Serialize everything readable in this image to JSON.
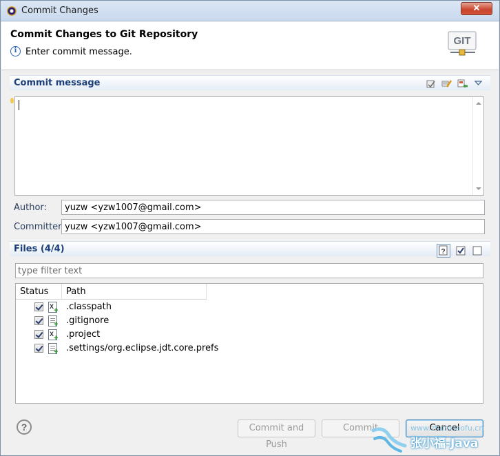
{
  "window": {
    "title": "Commit Changes",
    "close_label": "✕"
  },
  "header": {
    "title": "Commit Changes to Git Repository",
    "message": "Enter commit message.",
    "logo_text": "GIT"
  },
  "commit_message": {
    "section_title": "Commit message",
    "value": "",
    "tool_icons": [
      "spellcheck-icon",
      "edit-message-icon",
      "signed-off-icon",
      "view-menu-icon"
    ]
  },
  "author": {
    "label": "Author:",
    "value": "yuzw <yzw1007@gmail.com>"
  },
  "committer": {
    "label": "Committer:",
    "value": "yuzw <yzw1007@gmail.com>"
  },
  "files": {
    "section_title": "Files (4/4)",
    "filter_placeholder": "type filter text",
    "columns": [
      "Status",
      "Path"
    ],
    "rows": [
      {
        "path": ".classpath",
        "checked": true,
        "icon": "xml-file-add-icon"
      },
      {
        "path": ".gitignore",
        "checked": true,
        "icon": "text-file-add-icon"
      },
      {
        "path": ".project",
        "checked": true,
        "icon": "xml-file-add-icon"
      },
      {
        "path": ".settings/org.eclipse.jdt.core.prefs",
        "checked": true,
        "icon": "text-file-add-icon"
      }
    ]
  },
  "buttons": {
    "commit_and_push": "Commit and Push",
    "commit": "Commit",
    "cancel": "Cancel"
  },
  "watermark": {
    "url": "www.zhanxiaofu.cn",
    "name": "张小福-Java"
  }
}
